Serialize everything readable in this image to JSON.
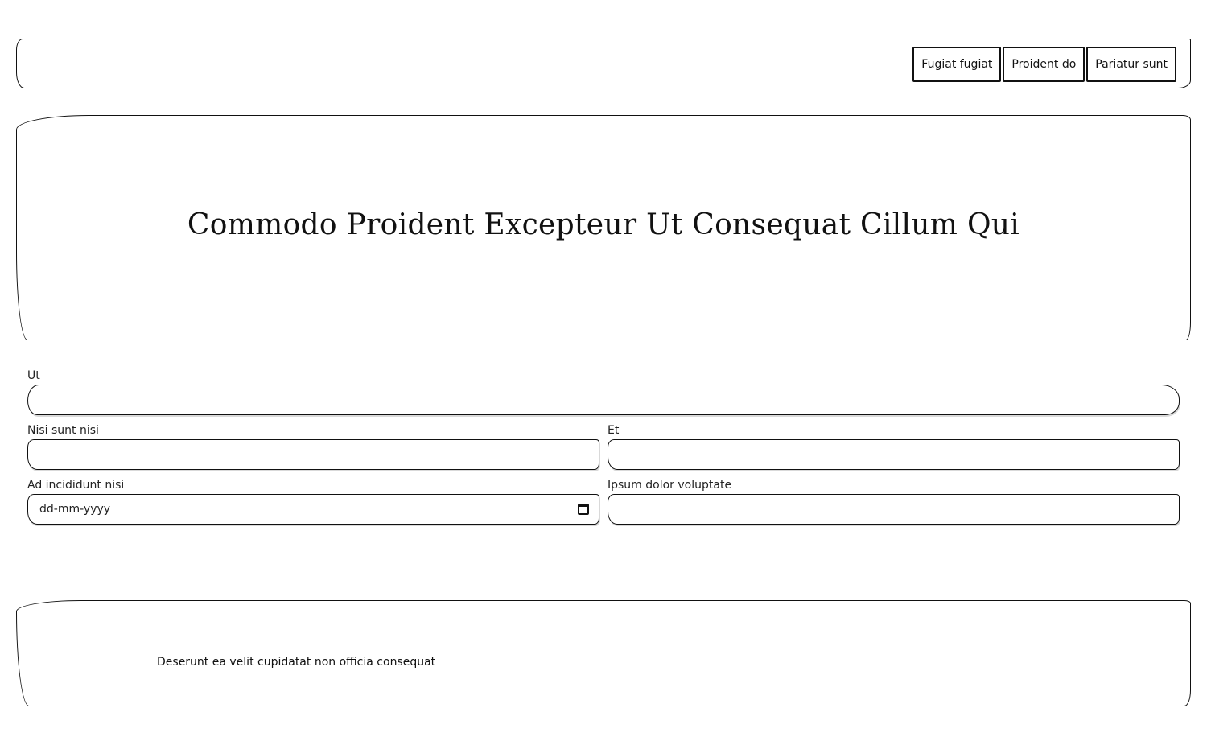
{
  "nav": {
    "items": [
      {
        "label": "Fugiat fugiat"
      },
      {
        "label": "Proident do"
      },
      {
        "label": "Pariatur sunt"
      }
    ]
  },
  "hero": {
    "title": "Commodo Proident Excepteur Ut Consequat Cillum Qui"
  },
  "form": {
    "field1": {
      "label": "Ut",
      "value": ""
    },
    "field2": {
      "label": "Nisi sunt nisi",
      "value": ""
    },
    "field3": {
      "label": "Et",
      "value": ""
    },
    "field4": {
      "label": "Ad incididunt nisi",
      "placeholder": "dd-mm-yyyy",
      "icon": "calendar-icon"
    },
    "field5": {
      "label": "Ipsum dolor voluptate",
      "value": ""
    }
  },
  "footer": {
    "text": "Deserunt ea velit cupidatat non officia consequat"
  }
}
